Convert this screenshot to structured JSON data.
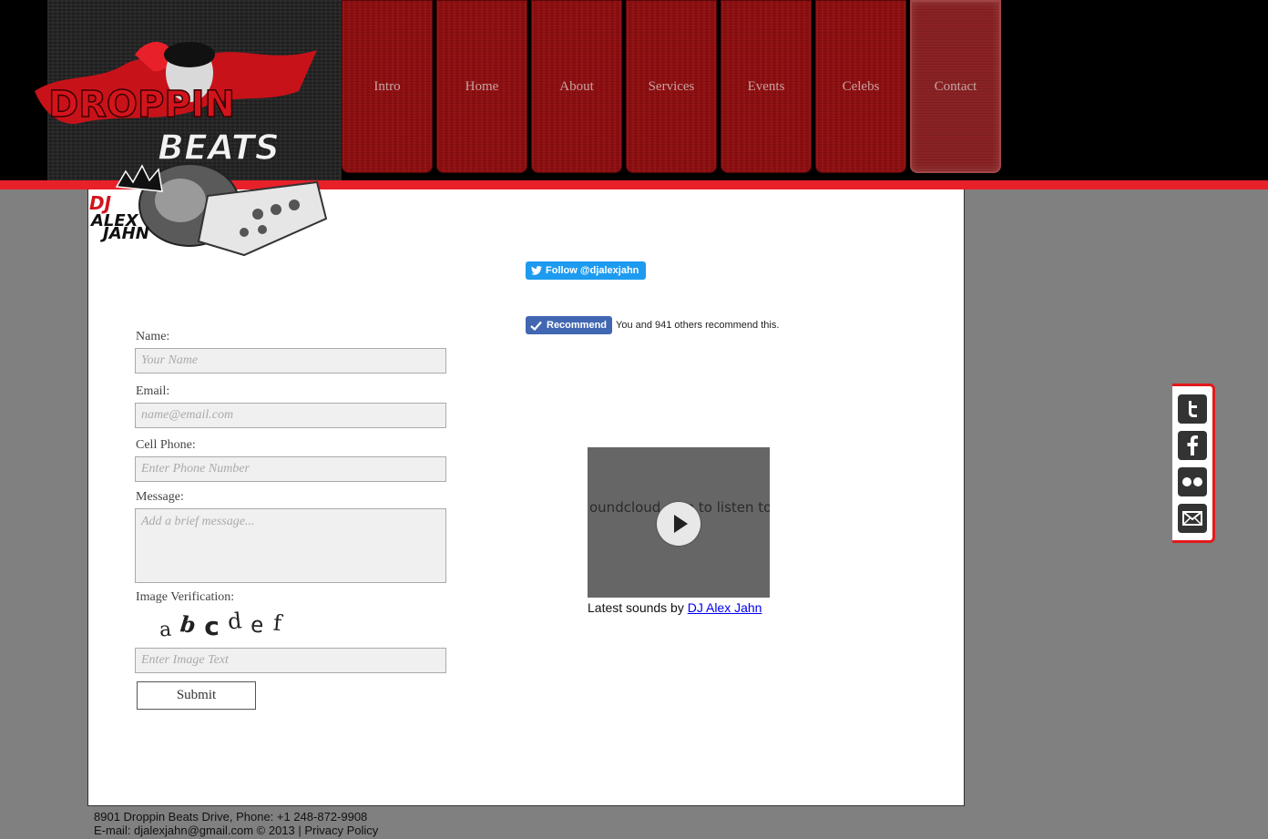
{
  "brand": {
    "logo_alt": "Droppin Beats - DJ Alex Jahn",
    "logo_text_1": "DROPPIN",
    "logo_text_2": "BEATS",
    "dj_text": "DJ",
    "dj_name_1": "ALEX",
    "dj_name_2": "JAHN"
  },
  "nav": {
    "items": [
      {
        "label": "Intro"
      },
      {
        "label": "Home"
      },
      {
        "label": "About"
      },
      {
        "label": "Services"
      },
      {
        "label": "Events"
      },
      {
        "label": "Celebs"
      },
      {
        "label": "Contact"
      }
    ],
    "active": "Contact"
  },
  "form": {
    "name_label": "Name:",
    "name_placeholder": "Your Name",
    "email_label": "Email:",
    "email_placeholder": "name@email.com",
    "phone_label": "Cell Phone:",
    "phone_placeholder": "Enter Phone Number",
    "message_label": "Message:",
    "message_placeholder": "Add a brief message...",
    "verification_label": "Image Verification:",
    "captcha_chars": [
      "a",
      "b",
      "c",
      "d",
      "e",
      "f"
    ],
    "captcha_placeholder": "Enter Image Text",
    "submit_label": "Submit"
  },
  "social_widgets": {
    "twitter_follow": "Follow @djalexjahn",
    "fb_recommend": "Recommend",
    "fb_text": "You and 941 others recommend this."
  },
  "soundcloud": {
    "overlay_text": "oundcloud.com to listen to",
    "caption_prefix": "Latest sounds by ",
    "caption_link": "DJ Alex Jahn"
  },
  "side_social": {
    "icons": [
      "twitter-icon",
      "facebook-icon",
      "flickr-icon",
      "email-icon"
    ]
  },
  "footer": {
    "line1": "8901 Droppin Beats Drive, Phone: +1 248-872-9908",
    "line2_prefix": "E-mail: djalexjahn@gmail.com © 2013 | ",
    "privacy_link": "Privacy Policy"
  },
  "colors": {
    "accent_red": "#e8202a",
    "nav_red": "#8e0e10",
    "twitter_blue": "#1d9bf0",
    "facebook_blue": "#4267b2"
  }
}
